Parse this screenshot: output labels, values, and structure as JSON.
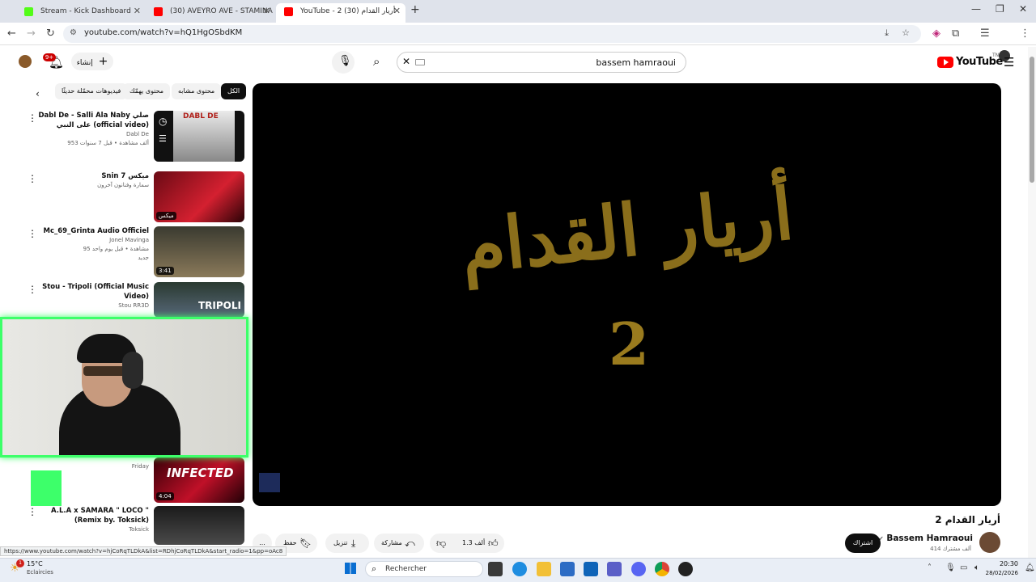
{
  "browser": {
    "tabs": [
      {
        "label": "Stream - Kick Dashboard",
        "fav_color": "#53fc18"
      },
      {
        "label": "(30) AVEYRO AVE - STAMINA [C",
        "fav_color": "#ff0000"
      },
      {
        "label": "YouTube - 2 أريار القدام (30)",
        "fav_color": "#ff0000"
      }
    ],
    "new_tab": "+",
    "url": "youtube.com/watch?v=hQ1HgOSbdKM",
    "status_url": "https://www.youtube.com/watch?v=hjCoRqTLDkA&list=RDhjCoRqTLDkA&start_radio=1&pp=oAc8"
  },
  "youtube": {
    "logo": "YouTube",
    "logo_region": "TN",
    "search_query": "bassem hamraoui",
    "create_label": "إنشاء",
    "notif_count": "9+",
    "chips": [
      "الكل",
      "محتوى مشابه",
      "محتوى يهمّك",
      "فيديوهات محمّلة حديثًا"
    ],
    "playlist": [
      {
        "title": "Dabl De - Salli Ala Naby صلي على النبي (official video)",
        "channel": "Dabl De",
        "meta": "953 ألف مشاهدة • قبل 7 سنوات",
        "duration": "",
        "thumb_text": "DABL DE"
      },
      {
        "title": "Snin 7 ميكس",
        "channel": "سمارة وفنانون آخرون",
        "meta": "",
        "duration": "ميكس",
        "thumb_text": ""
      },
      {
        "title": "Mc_69_Grinta Audio Officiel",
        "channel": "Jonel Mavinga",
        "meta": "95 مشاهدة • قبل يوم واحد",
        "badge": "جديد",
        "duration": "3:41",
        "thumb_text": ""
      },
      {
        "title": "Stou - Tripoli (Official Music Video)",
        "channel": "Stou RR3D",
        "meta": "",
        "duration": "",
        "thumb_text": "TRIPOLI"
      },
      {
        "title": "",
        "channel": "Friday",
        "meta": "",
        "duration": "4:04",
        "thumb_text": "INFECTED"
      },
      {
        "title": "A.L.A x SAMARA \" LOCO \" (Remix by. Toksick)",
        "channel": "Toksick",
        "meta": "",
        "duration": "",
        "thumb_text": ""
      }
    ],
    "video": {
      "title": "أريار القدام 2",
      "art_text": "أريار القدام",
      "art_number": "2",
      "channel_name": "Bassem Hamraoui",
      "subscribers": "414 ألف مشترك",
      "subscribe_label": "اشتراك",
      "likes": "1.3 ألف",
      "share_label": "مشاركة",
      "download_label": "تنزيل",
      "save_label": "حفظ",
      "more": "..."
    }
  },
  "taskbar": {
    "weather_temp": "15°C",
    "weather_desc": "Eclaircies",
    "weather_badge": "1",
    "search_placeholder": "Rechercher",
    "time": "20:30",
    "date": "28/02/2026"
  },
  "colors": {
    "accent_green": "#3dff6a",
    "youtube_red": "#ff0000",
    "gold_art": "#9a7b1e"
  }
}
